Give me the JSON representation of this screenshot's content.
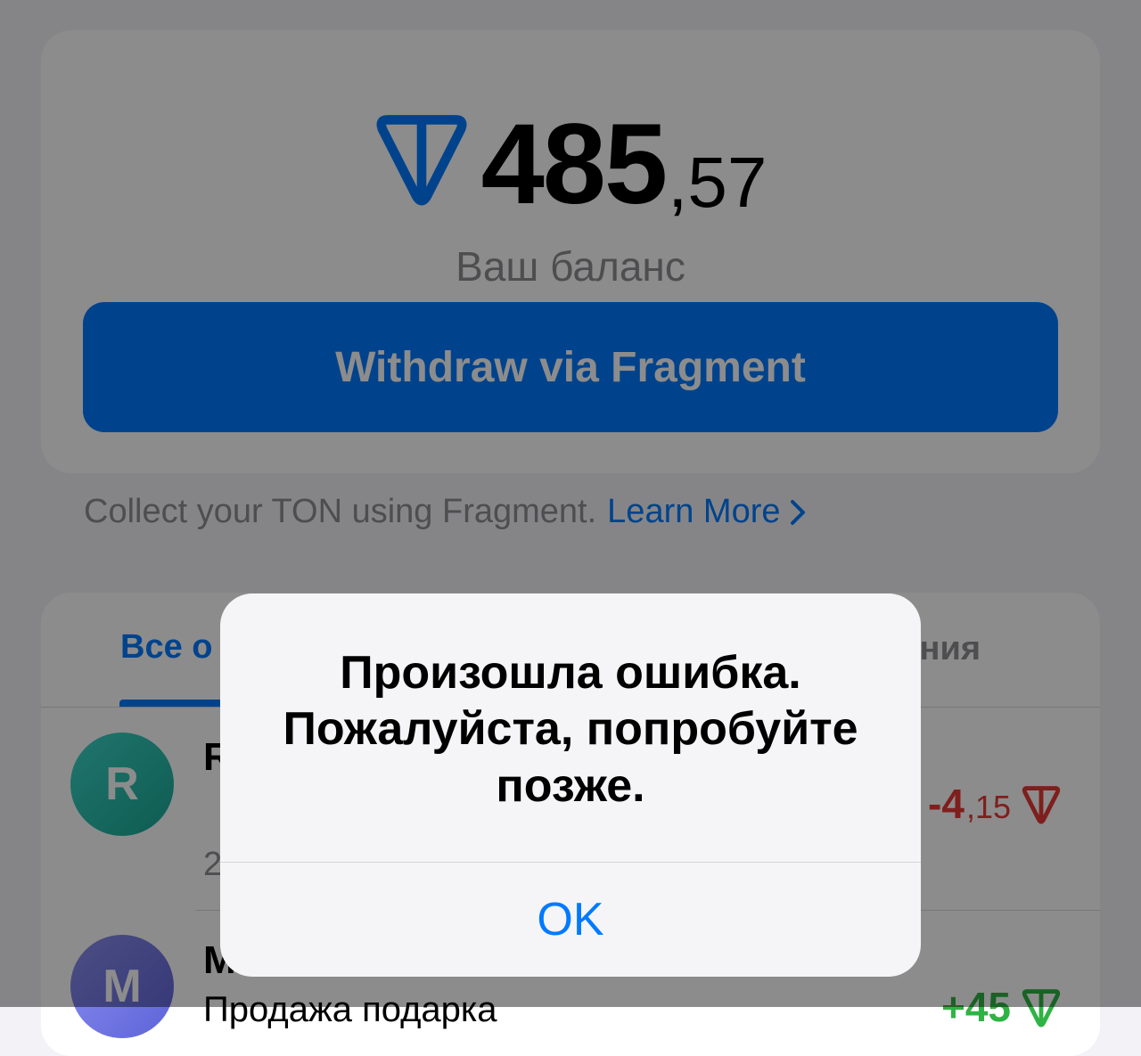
{
  "balance": {
    "integer": "485",
    "fraction": ",57",
    "label": "Ваш баланс",
    "currency_icon": "ton-icon"
  },
  "withdraw_button": "Withdraw via Fragment",
  "collect": {
    "text": "Collect your TON using Fragment.",
    "link": "Learn More"
  },
  "tabs": {
    "all": "Все о",
    "right_partial": "ния"
  },
  "transactions": [
    {
      "avatar_letter": "R",
      "name": "R",
      "sub": "",
      "date": "2",
      "amount_int": "-4",
      "amount_frac": ",15",
      "color": "#e53935"
    },
    {
      "avatar_letter": "M",
      "name": "M",
      "sub": "Продажа подарка",
      "amount_int": "+45",
      "amount_frac": "",
      "color": "#2fb344"
    }
  ],
  "alert": {
    "title": "Произошла ошибка. Пожалуйста, попробуйте позже.",
    "button": "OK"
  },
  "colors": {
    "accent": "#007aff",
    "negative": "#e53935",
    "positive": "#2fb344"
  }
}
